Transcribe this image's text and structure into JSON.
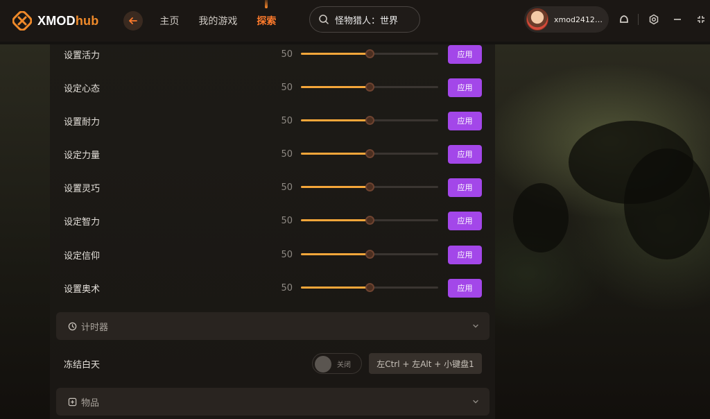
{
  "app": {
    "brand_main": "XMOD",
    "brand_accent": "hub"
  },
  "nav": {
    "items": [
      {
        "label": "主页",
        "active": false
      },
      {
        "label": "我的游戏",
        "active": false
      },
      {
        "label": "探索",
        "active": true
      }
    ]
  },
  "search": {
    "value": "怪物猎人：世界"
  },
  "user": {
    "name": "xmod24123..."
  },
  "colors": {
    "accent": "#ff7b2c",
    "apply": "#a347e9",
    "slider_fill": "#f4a63a"
  },
  "sliders": [
    {
      "label": "设置活力",
      "value": "50",
      "fill": 0.5,
      "button": "应用"
    },
    {
      "label": "设定心态",
      "value": "50",
      "fill": 0.5,
      "button": "应用"
    },
    {
      "label": "设置耐力",
      "value": "50",
      "fill": 0.5,
      "button": "应用"
    },
    {
      "label": "设定力量",
      "value": "50",
      "fill": 0.5,
      "button": "应用"
    },
    {
      "label": "设置灵巧",
      "value": "50",
      "fill": 0.5,
      "button": "应用"
    },
    {
      "label": "设定智力",
      "value": "50",
      "fill": 0.5,
      "button": "应用"
    },
    {
      "label": "设定信仰",
      "value": "50",
      "fill": 0.5,
      "button": "应用"
    },
    {
      "label": "设置奥术",
      "value": "50",
      "fill": 0.5,
      "button": "应用"
    }
  ],
  "timer_section": {
    "label": "计时器",
    "icon": "clock-icon"
  },
  "freeze_day": {
    "label": "冻结白天",
    "toggle_state": "关闭",
    "hotkey": "左Ctrl + 左Alt + 小键盘1"
  },
  "items_section": {
    "label": "物品",
    "icon": "plus-square-icon"
  }
}
